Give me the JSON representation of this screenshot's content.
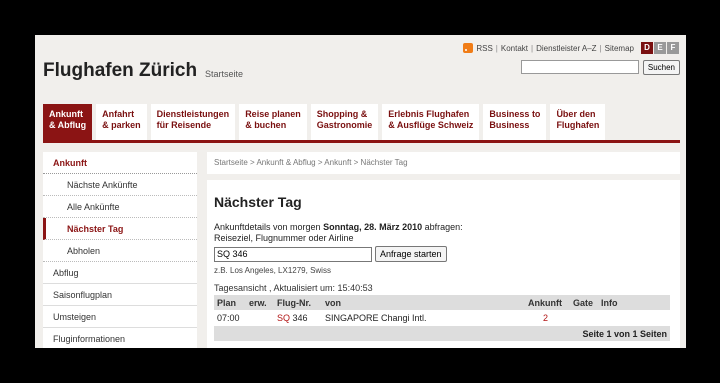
{
  "util": {
    "rss": "RSS",
    "kontakt": "Kontakt",
    "dienstleister": "Dienstleister A–Z",
    "sitemap": "Sitemap",
    "langs": [
      "D",
      "E",
      "F"
    ]
  },
  "brand": {
    "title": "Flughafen Zürich",
    "subtitle": "Startseite"
  },
  "search": {
    "button": "Suchen",
    "value": ""
  },
  "nav": [
    {
      "l1": "Ankunft",
      "l2": "& Abflug"
    },
    {
      "l1": "Anfahrt",
      "l2": "& parken"
    },
    {
      "l1": "Dienstleistungen",
      "l2": "für Reisende"
    },
    {
      "l1": "Reise planen",
      "l2": "& buchen"
    },
    {
      "l1": "Shopping &",
      "l2": "Gastronomie"
    },
    {
      "l1": "Erlebnis Flughafen",
      "l2": "& Ausflüge Schweiz"
    },
    {
      "l1": "Business to",
      "l2": "Business"
    },
    {
      "l1": "Über den",
      "l2": "Flughafen"
    }
  ],
  "sidebar": [
    "Ankunft",
    "Nächste Ankünfte",
    "Alle Ankünfte",
    "Nächster Tag",
    "Abholen",
    "Abflug",
    "Saisonflugplan",
    "Umsteigen",
    "Fluginformationen"
  ],
  "breadcrumb": "Startseite > Ankunft & Abflug > Ankunft > Nächster Tag",
  "content": {
    "title": "Nächster Tag",
    "intro_pre": "Ankunftdetails von morgen ",
    "intro_date": "Sonntag, 28. März 2010",
    "intro_post": " abfragen:",
    "label": "Reiseziel, Flugnummer oder Airline",
    "query": "SQ 346",
    "button": "Anfrage starten",
    "hint": "z.B. Los Angeles, LX1279, Swiss",
    "status": "Tagesansicht , Aktualisiert um: 15:40:53"
  },
  "table": {
    "headers": [
      "Plan",
      "erw.",
      "Flug-Nr.",
      "von",
      "Ankunft",
      "Gate",
      "Info"
    ],
    "row": {
      "plan": "07:00",
      "erw": "",
      "airline": "SQ",
      "number": "346",
      "from": "SINGAPORE Changi Intl.",
      "ankunft": "2",
      "gate": "",
      "info": ""
    },
    "footer": "Seite 1 von 1 Seiten"
  },
  "colors": {
    "brand": "#8b1414"
  }
}
